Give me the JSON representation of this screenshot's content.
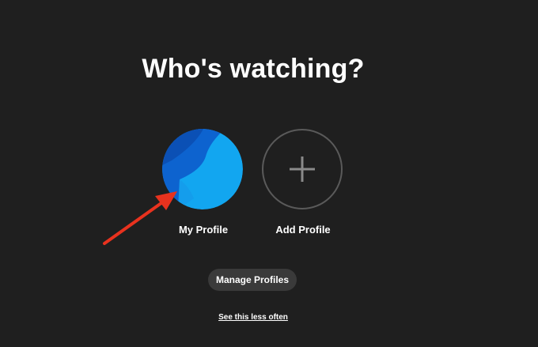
{
  "heading": "Who's watching?",
  "profiles": [
    {
      "label": "My Profile",
      "icon": "profile-avatar"
    },
    {
      "label": "Add Profile",
      "icon": "plus-icon"
    }
  ],
  "manage_button": "Manage Profiles",
  "see_less_link": "See this less often",
  "colors": {
    "background": "#1f1f1f",
    "button_bg": "#3a3a3a",
    "avatar_primary": "#1aa3ee",
    "avatar_dark": "#0a57c2",
    "annotation_arrow": "#e8321e"
  }
}
